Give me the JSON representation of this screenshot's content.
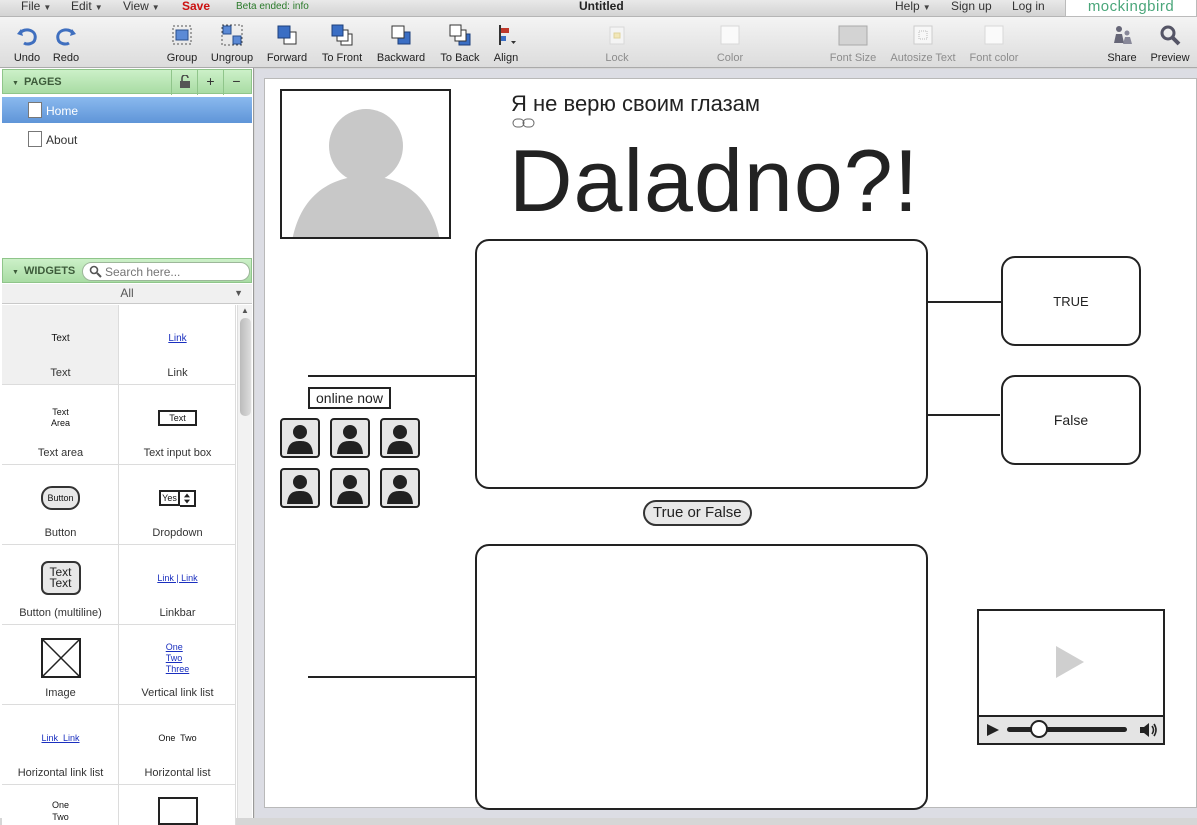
{
  "menubar": {
    "file": "File",
    "edit": "Edit",
    "view": "View",
    "save": "Save",
    "beta": "Beta ended: info",
    "title": "Untitled",
    "help": "Help",
    "signup": "Sign up",
    "login": "Log in",
    "brand": "mockingbird"
  },
  "toolbar": {
    "undo": "Undo",
    "redo": "Redo",
    "group": "Group",
    "ungroup": "Ungroup",
    "forward": "Forward",
    "to_front": "To Front",
    "backward": "Backward",
    "to_back": "To Back",
    "align": "Align",
    "lock": "Lock",
    "color": "Color",
    "font_size": "Font Size",
    "autosize_text": "Autosize Text",
    "font_color": "Font color",
    "share": "Share",
    "preview": "Preview"
  },
  "pages": {
    "header": "PAGES",
    "items": [
      "Home",
      "About"
    ],
    "selected": "Home"
  },
  "widgets": {
    "header": "WIDGETS",
    "search_placeholder": "Search here...",
    "filter": "All",
    "items": [
      {
        "label": "Text",
        "preview": "Text"
      },
      {
        "label": "Link",
        "preview": "Link"
      },
      {
        "label": "Text area",
        "preview": "Text\nArea"
      },
      {
        "label": "Text input box",
        "preview": "Text"
      },
      {
        "label": "Button",
        "preview": "Button"
      },
      {
        "label": "Dropdown",
        "preview": "Yes"
      },
      {
        "label": "Button (multiline)",
        "preview": "Text\nText"
      },
      {
        "label": "Linkbar",
        "preview": "Link | Link"
      },
      {
        "label": "Image",
        "preview": ""
      },
      {
        "label": "Vertical link list",
        "preview": "One\nTwo\nThree"
      },
      {
        "label": "Horizontal link list",
        "preview": "Link  Link"
      },
      {
        "label": "Horizontal list",
        "preview": "One  Two"
      },
      {
        "label": "",
        "preview": "One\nTwo"
      },
      {
        "label": "",
        "preview": ""
      }
    ]
  },
  "canvas": {
    "subtitle": "Я не верю своим глазам",
    "headline": "Daladno?!",
    "online_label": "online now",
    "true_label": "TRUE",
    "false_label": "False",
    "question_button": "True or False"
  }
}
